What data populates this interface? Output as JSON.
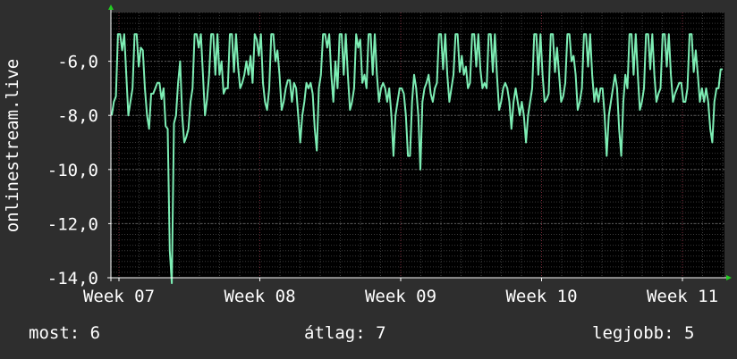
{
  "colors": {
    "background": "#2e2e2e",
    "plot_background": "#000000",
    "line": "#7dedb4",
    "grid_major_h": "#5a5a5a",
    "grid_minor_h": "#3a3a3a",
    "grid_v": "#7a2a3a",
    "axis": "#ffffff",
    "arrow": "#22cc22"
  },
  "legend": {
    "now_label": "most:",
    "now_value": "6",
    "avg_label": "átlag:",
    "avg_value": "7",
    "max_label": "legjobb:",
    "max_value": "5"
  },
  "chart_data": {
    "type": "line",
    "title": "",
    "ylabel": "onlinestream.live",
    "xlabel": "",
    "y_inverted": true,
    "ylim": [
      -14.0,
      -4.2
    ],
    "yticks": [
      -6.0,
      -8.0,
      -10.0,
      -12.0,
      -14.0
    ],
    "ytick_labels": [
      "-6,0",
      "-8,0",
      "-10,0",
      "-12,0",
      "-14,0"
    ],
    "xticks": [
      "Week 07",
      "Week 08",
      "Week 09",
      "Week 10",
      "Week 11"
    ],
    "grid": true,
    "series": [
      {
        "values": [
          -8,
          -7.5,
          -7.3,
          -5,
          -5,
          -5.6,
          -5,
          -6.5,
          -8,
          -7.5,
          -7,
          -5,
          -5,
          -6.2,
          -5.5,
          -5.6,
          -7,
          -8,
          -8.5,
          -7.2,
          -7.2,
          -7,
          -6.8,
          -6.8,
          -7.4,
          -7,
          -8.4,
          -8.5,
          -13,
          -14.2,
          -8.3,
          -8,
          -6.8,
          -6,
          -8,
          -9,
          -8.8,
          -8.5,
          -7.5,
          -7,
          -5,
          -5,
          -5.5,
          -5,
          -6.5,
          -8,
          -7.4,
          -6.5,
          -5,
          -5,
          -6.5,
          -5,
          -6.5,
          -6,
          -7.2,
          -7,
          -7,
          -5,
          -5,
          -6.4,
          -5,
          -6.2,
          -7,
          -6.8,
          -6.5,
          -6,
          -6.5,
          -5.8,
          -6.8,
          -5,
          -5.2,
          -5.8,
          -5,
          -6.8,
          -7.5,
          -7.8,
          -7,
          -5,
          -5,
          -6,
          -5.6,
          -6.5,
          -7.8,
          -7.5,
          -7,
          -6.7,
          -6.7,
          -7.5,
          -6.8,
          -7,
          -8,
          -9,
          -8,
          -7.5,
          -6.8,
          -7,
          -6.8,
          -7.2,
          -8.5,
          -9.3,
          -7,
          -6.5,
          -5,
          -5,
          -5.5,
          -5,
          -6.5,
          -7.5,
          -6,
          -7,
          -5,
          -5,
          -6.5,
          -5,
          -6.5,
          -7.8,
          -7.5,
          -7,
          -5,
          -5.5,
          -5.2,
          -6.8,
          -6.5,
          -7,
          -5,
          -5,
          -6.5,
          -5,
          -6.5,
          -7.5,
          -7,
          -6.8,
          -7,
          -7.5,
          -7,
          -8,
          -9.5,
          -8,
          -7.5,
          -7,
          -7,
          -7.2,
          -8,
          -9.5,
          -9.5,
          -7.5,
          -6.5,
          -7,
          -8,
          -10,
          -7.5,
          -7,
          -6.8,
          -6.5,
          -7.2,
          -7.5,
          -7,
          -6.8,
          -5,
          -5,
          -6.3,
          -5,
          -6.5,
          -7.5,
          -7,
          -6.5,
          -5,
          -5,
          -6.4,
          -5.8,
          -6.5,
          -6.2,
          -7,
          -6.8,
          -5,
          -5,
          -6.2,
          -5,
          -6.3,
          -7,
          -6.8,
          -7,
          -5,
          -5,
          -6.4,
          -5,
          -6.5,
          -7.8,
          -7.5,
          -7,
          -6.8,
          -7,
          -7.5,
          -8.5,
          -7.5,
          -7,
          -7.5,
          -8,
          -7.5,
          -8,
          -9,
          -8,
          -7.5,
          -7,
          -5,
          -5,
          -6.5,
          -5,
          -6.5,
          -7.5,
          -7.4,
          -7.2,
          -5,
          -5,
          -6.4,
          -5.5,
          -6.5,
          -7.5,
          -7.3,
          -6.8,
          -5,
          -5,
          -6,
          -5.8,
          -6.5,
          -7.8,
          -7.5,
          -7,
          -5,
          -5,
          -6.2,
          -5,
          -6.5,
          -7.5,
          -7,
          -7.5,
          -7,
          -7,
          -8,
          -9.5,
          -8,
          -7.5,
          -7,
          -6.5,
          -7,
          -8.5,
          -9.5,
          -7.5,
          -6.5,
          -7,
          -5,
          -5,
          -6.5,
          -5,
          -6.5,
          -7.8,
          -7.5,
          -7,
          -5,
          -5,
          -6.3,
          -5,
          -6.5,
          -7.5,
          -7.2,
          -7,
          -5,
          -5,
          -6.2,
          -5,
          -6.5,
          -7.5,
          -7.2,
          -7,
          -6.8,
          -6.8,
          -7.5,
          -7.5,
          -7,
          -5,
          -5,
          -6.4,
          -5.6,
          -6.5,
          -7.5,
          -7,
          -7.5,
          -7,
          -7.5,
          -8.5,
          -9,
          -7.5,
          -7,
          -7,
          -6.3,
          -6.3
        ]
      }
    ]
  }
}
